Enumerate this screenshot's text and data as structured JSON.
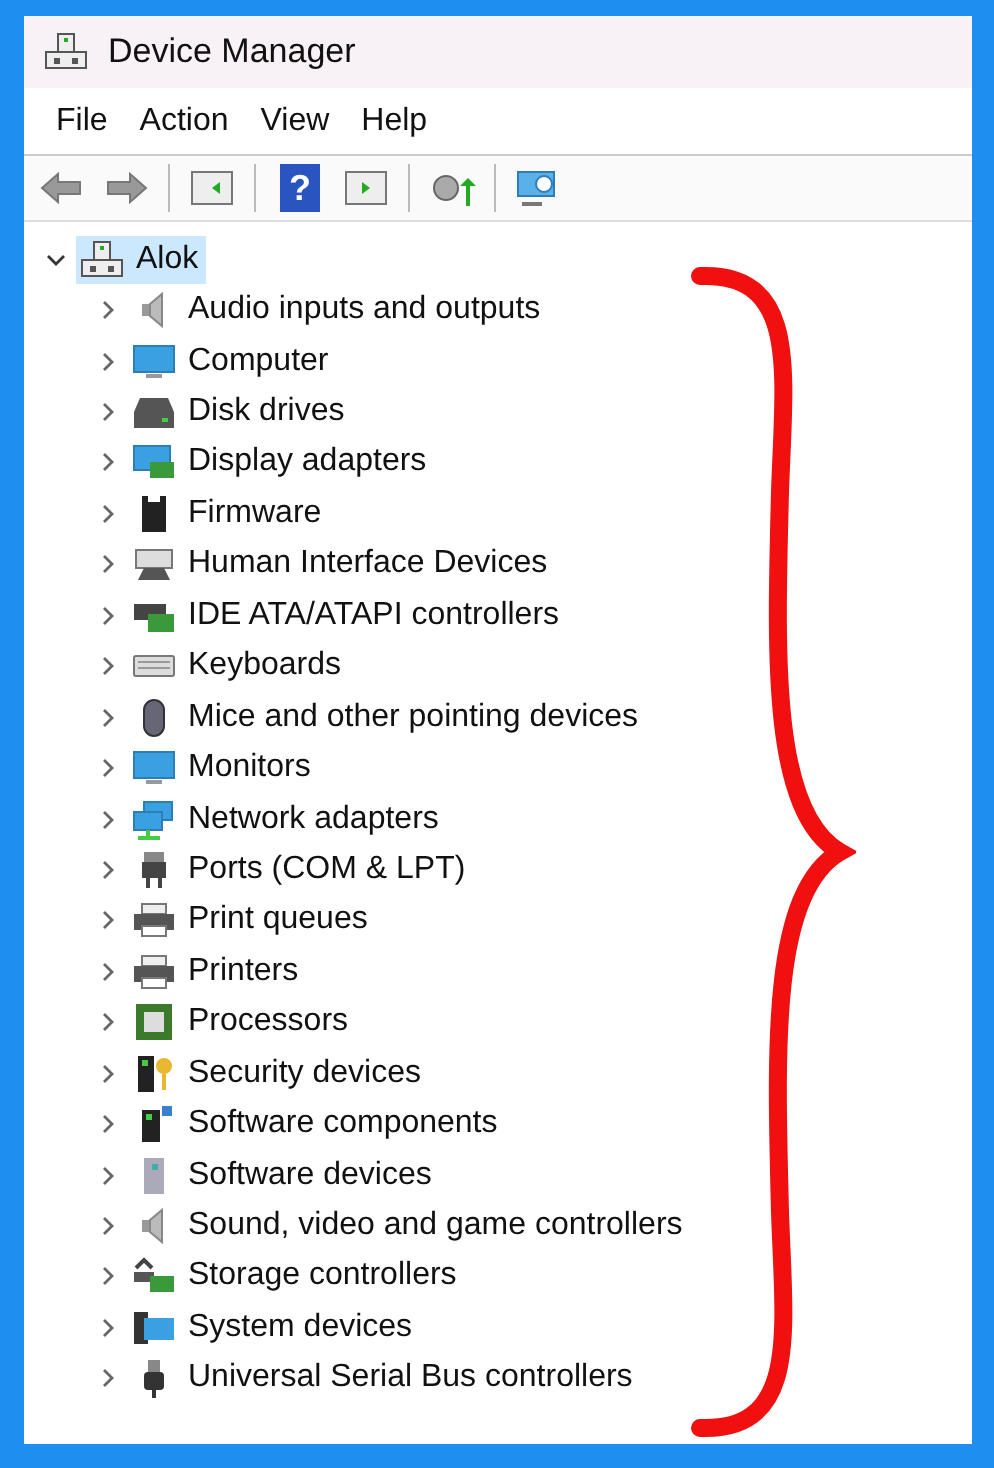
{
  "window": {
    "title": "Device Manager"
  },
  "menu": [
    "File",
    "Action",
    "View",
    "Help"
  ],
  "toolbar": [
    {
      "kind": "back"
    },
    {
      "kind": "forward"
    },
    {
      "kind": "separator"
    },
    {
      "kind": "tree-pane"
    },
    {
      "kind": "separator"
    },
    {
      "kind": "help",
      "glyph": "?"
    },
    {
      "kind": "action-pane"
    },
    {
      "kind": "separator"
    },
    {
      "kind": "update-driver"
    },
    {
      "kind": "separator"
    },
    {
      "kind": "scan"
    }
  ],
  "tree": {
    "label": "Alok",
    "expanded": true,
    "selected": true,
    "children": [
      {
        "label": "Audio inputs and outputs",
        "expanded": false,
        "selected": false
      },
      {
        "label": "Computer",
        "expanded": false,
        "selected": false
      },
      {
        "label": "Disk drives",
        "expanded": false,
        "selected": false
      },
      {
        "label": "Display adapters",
        "expanded": false,
        "selected": false
      },
      {
        "label": "Firmware",
        "expanded": false,
        "selected": false
      },
      {
        "label": "Human Interface Devices",
        "expanded": false,
        "selected": false
      },
      {
        "label": "IDE ATA/ATAPI controllers",
        "expanded": false,
        "selected": false
      },
      {
        "label": "Keyboards",
        "expanded": false,
        "selected": false
      },
      {
        "label": "Mice and other pointing devices",
        "expanded": false,
        "selected": false
      },
      {
        "label": "Monitors",
        "expanded": false,
        "selected": false
      },
      {
        "label": "Network adapters",
        "expanded": false,
        "selected": false
      },
      {
        "label": "Ports (COM & LPT)",
        "expanded": false,
        "selected": false
      },
      {
        "label": "Print queues",
        "expanded": false,
        "selected": false
      },
      {
        "label": "Printers",
        "expanded": false,
        "selected": false
      },
      {
        "label": "Processors",
        "expanded": false,
        "selected": false
      },
      {
        "label": "Security devices",
        "expanded": false,
        "selected": false
      },
      {
        "label": "Software components",
        "expanded": false,
        "selected": false
      },
      {
        "label": "Software devices",
        "expanded": false,
        "selected": false
      },
      {
        "label": "Sound, video and game controllers",
        "expanded": false,
        "selected": false
      },
      {
        "label": "Storage controllers",
        "expanded": false,
        "selected": false
      },
      {
        "label": "System devices",
        "expanded": false,
        "selected": false
      },
      {
        "label": "Universal Serial Bus controllers",
        "expanded": false,
        "selected": false
      }
    ]
  }
}
